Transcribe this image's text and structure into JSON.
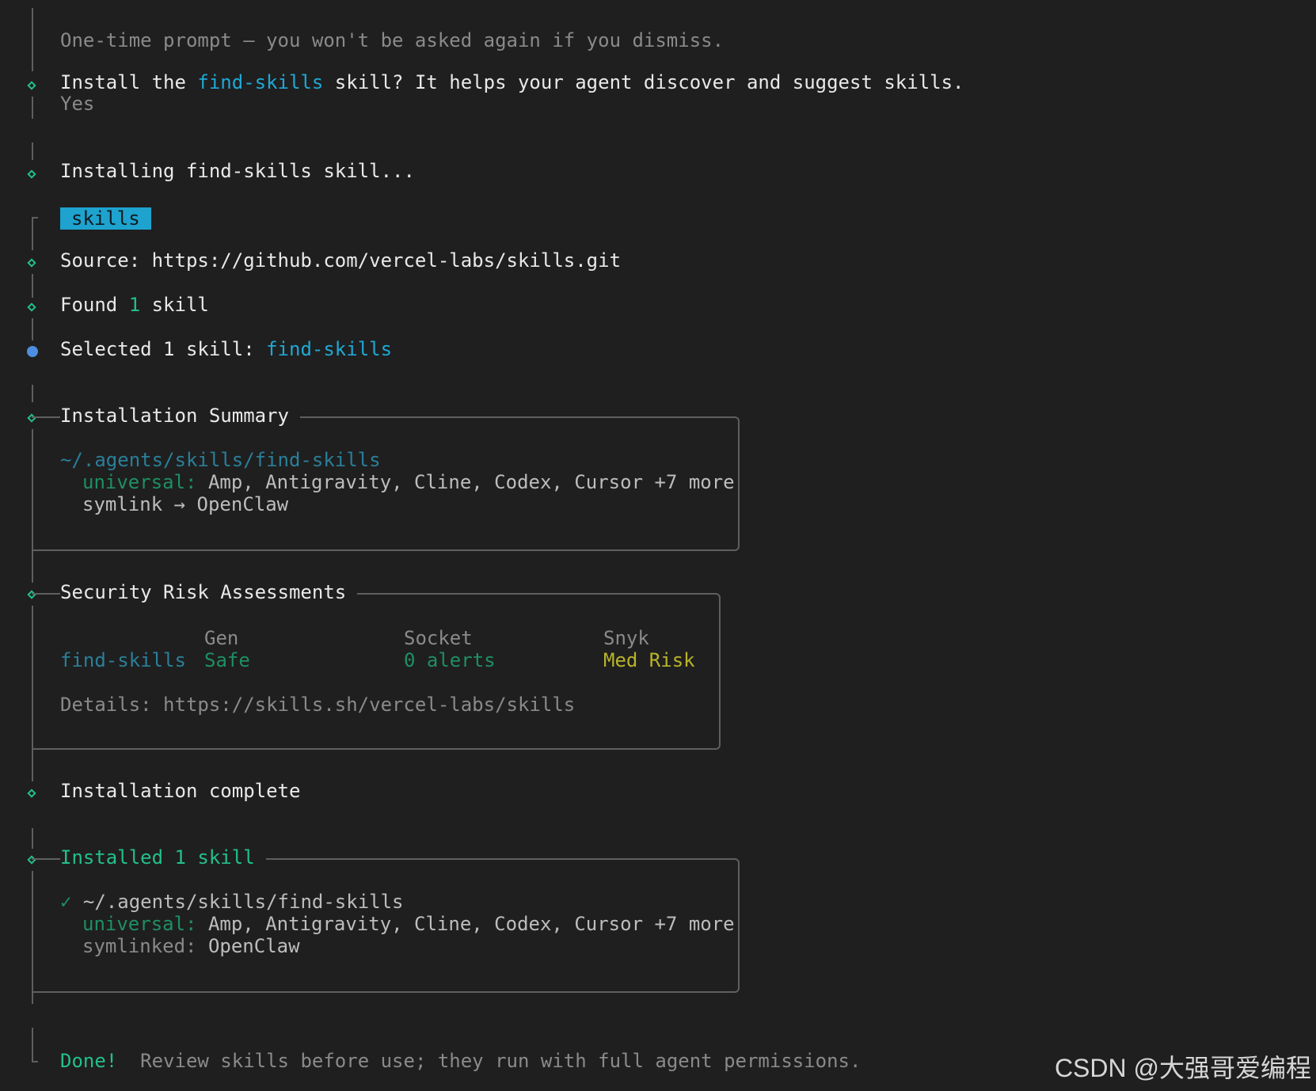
{
  "prompt_note": "One-time prompt – you won't be asked again if you dismiss.",
  "install_question": {
    "prefix": "Install the ",
    "skill_name": "find-skills",
    "suffix": " skill? It helps your agent discover and suggest skills.",
    "answer": "Yes"
  },
  "installing_text": "Installing find-skills skill...",
  "badge_label": "skills",
  "source": {
    "label": "Source: ",
    "url": "https://github.com/vercel-labs/skills.git"
  },
  "found": {
    "prefix": "Found ",
    "count": "1",
    "suffix": " skill"
  },
  "selected": {
    "prefix": "Selected 1 skill: ",
    "skill": "find-skills"
  },
  "summary": {
    "title": "Installation Summary",
    "path": "~/.agents/skills/find-skills",
    "universal_label": "universal:",
    "universal_value": " Amp, Antigravity, Cline, Codex, Cursor +7 more",
    "symlink_label": "symlink",
    "symlink_arrow": " → ",
    "symlink_value": "OpenClaw"
  },
  "security": {
    "title": "Security Risk Assessments",
    "headers": [
      "Gen",
      "Socket",
      "Snyk"
    ],
    "skill": "find-skills",
    "values": [
      "Safe",
      "0 alerts",
      "Med Risk"
    ],
    "details_label": "Details: ",
    "details_url": "https://skills.sh/vercel-labs/skills"
  },
  "complete_text": "Installation complete",
  "installed": {
    "title": "Installed 1 skill",
    "check": "✓",
    "path": "~/.agents/skills/find-skills",
    "universal_label": "universal:",
    "universal_value": " Amp, Antigravity, Cline, Codex, Cursor +7 more",
    "symlinked_label": "symlinked:",
    "symlinked_value": " OpenClaw"
  },
  "done": {
    "label": "Done!",
    "message": "Review skills before use; they run with full agent permissions."
  },
  "watermark": "CSDN @大强哥爱编程"
}
